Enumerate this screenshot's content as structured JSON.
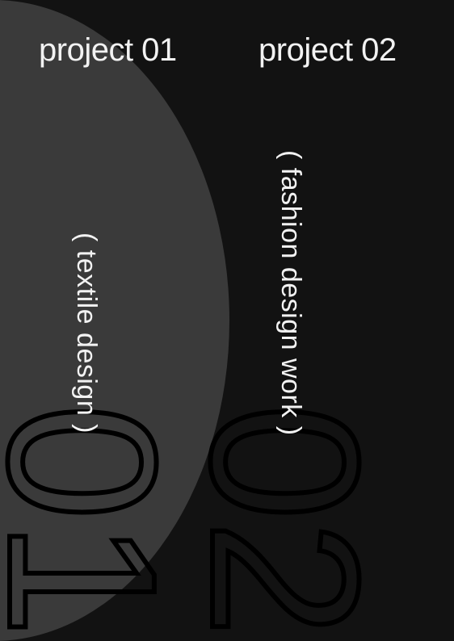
{
  "projects": [
    {
      "title": "project 01",
      "subtitle": "( textile design )",
      "numeral": "01"
    },
    {
      "title": "project 02",
      "subtitle": "( fashion design work )",
      "numeral": "02"
    }
  ],
  "colors": {
    "background": "#121212",
    "shape": "#3a3a3a",
    "text": "#f2f2f2",
    "numeral_outline": "#000000"
  }
}
